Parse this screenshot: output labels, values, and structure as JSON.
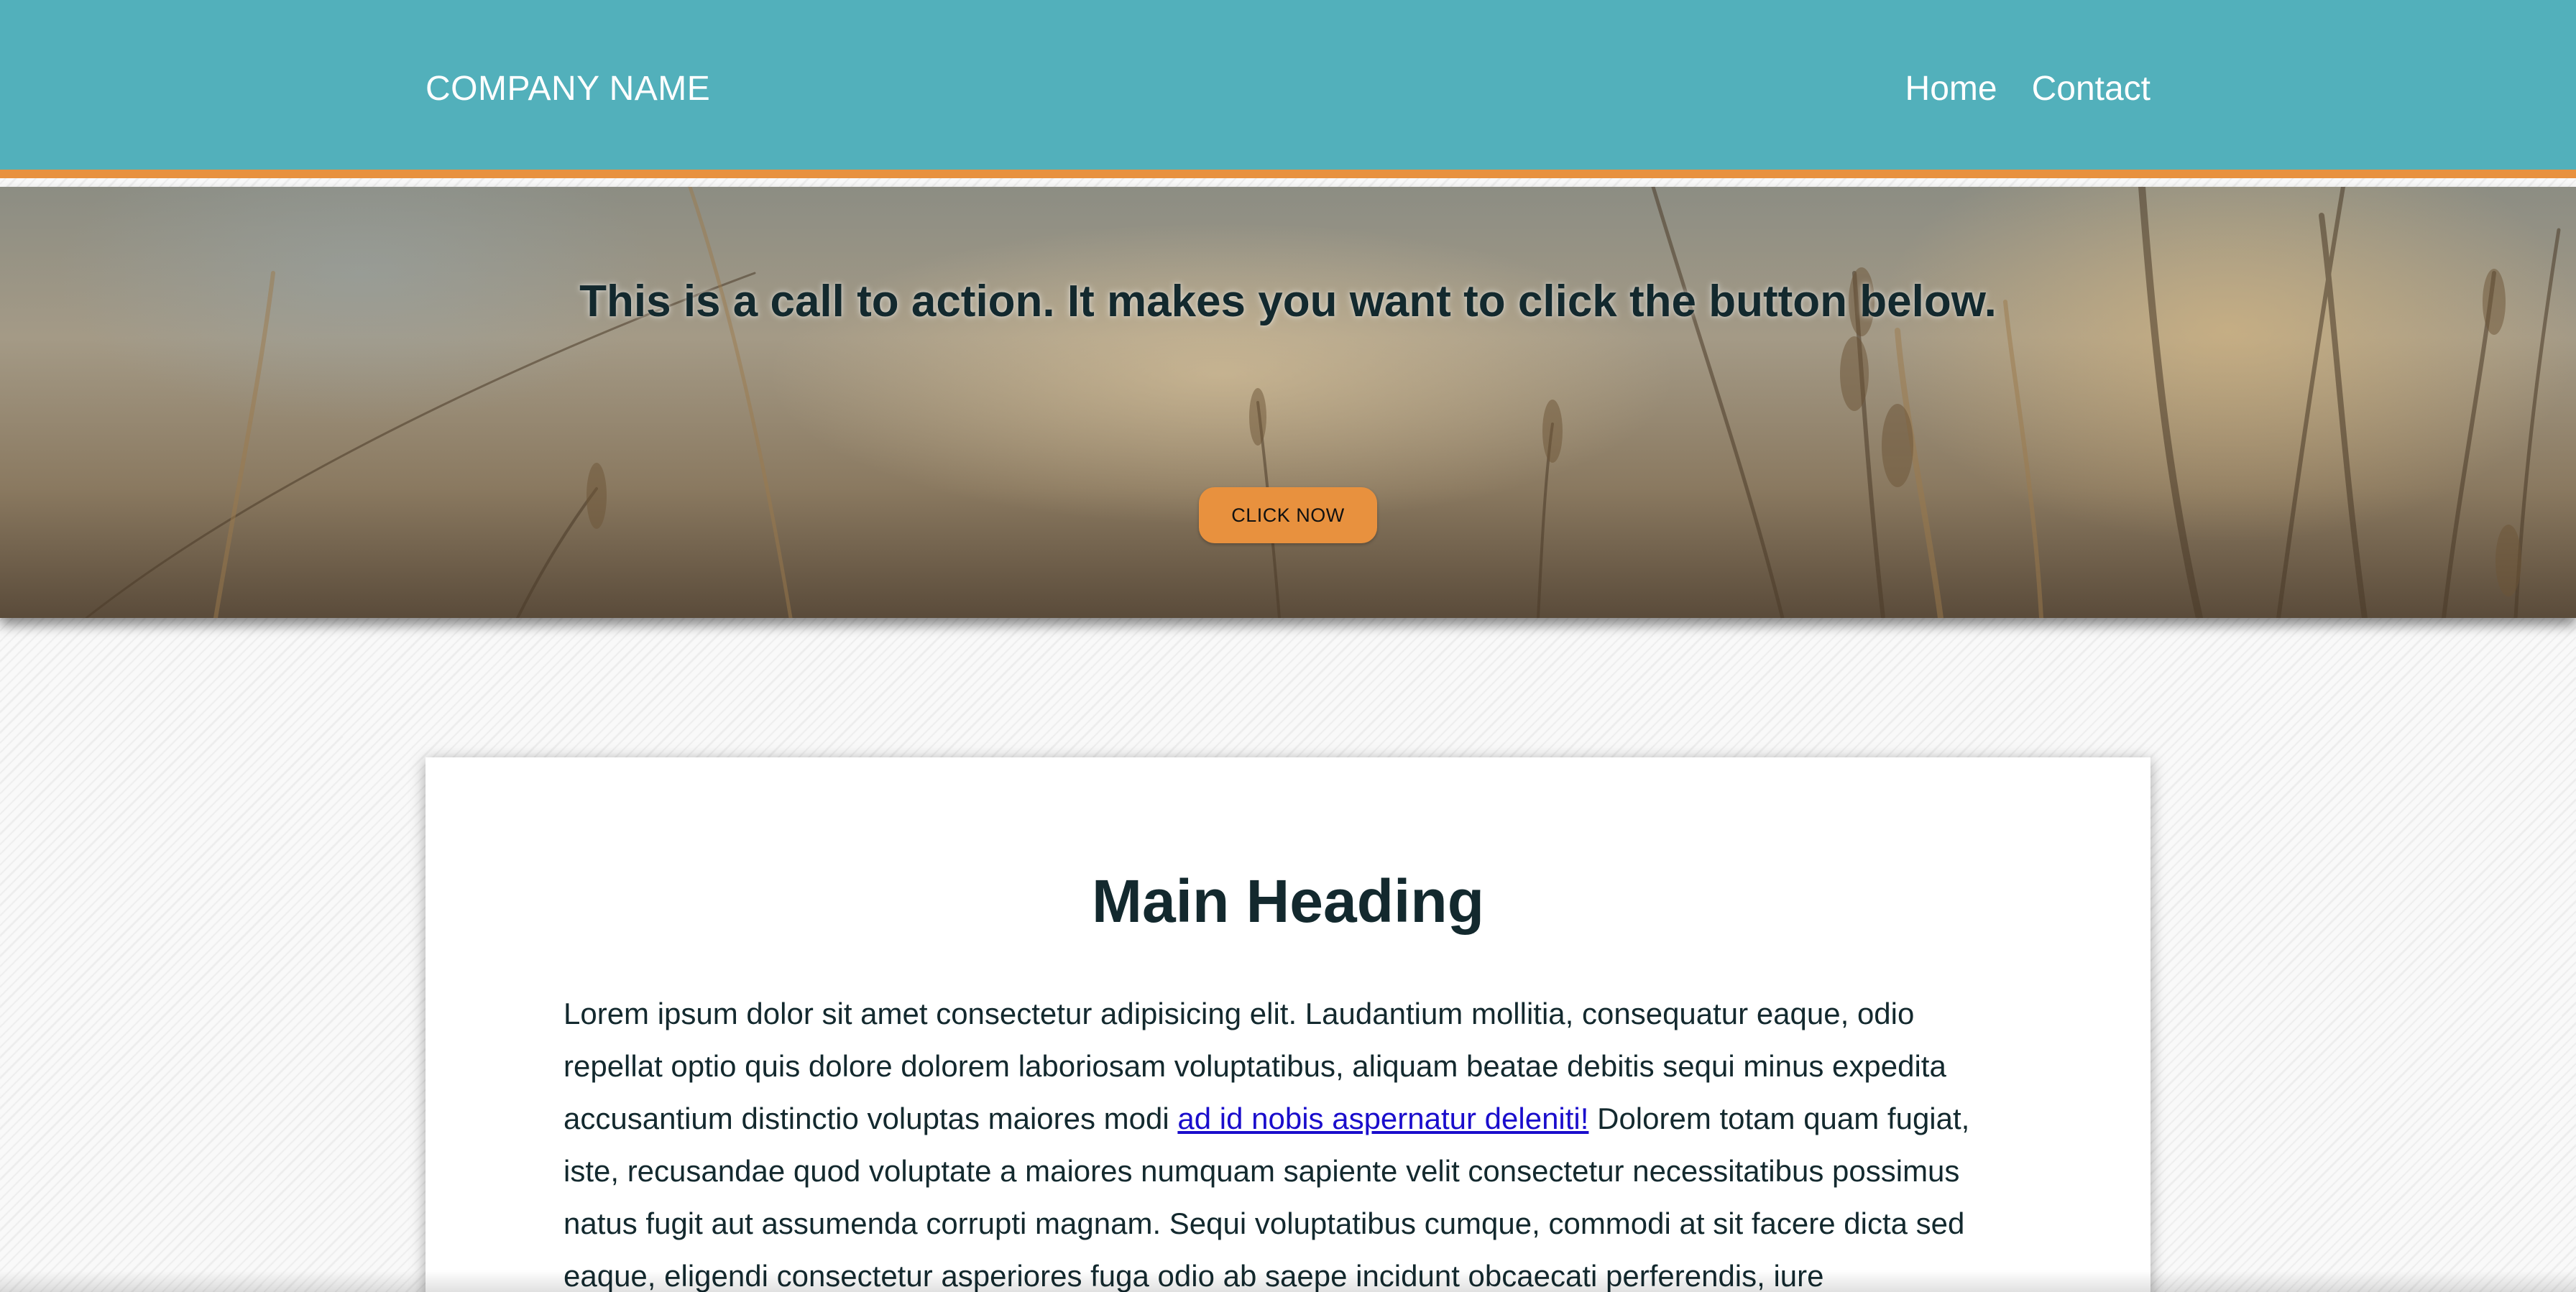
{
  "header": {
    "logo": "COMPANY NAME",
    "nav": [
      {
        "label": "Home"
      },
      {
        "label": "Contact"
      }
    ],
    "colors": {
      "background": "#52b0bb",
      "accent_border": "#e8913e"
    }
  },
  "hero": {
    "title": "This is a call to action. It makes you want to click the button below.",
    "button_label": "CLICK NOW",
    "background_image": "blurred wheat field photo"
  },
  "main": {
    "heading": "Main Heading",
    "paragraph_before_link": "Lorem ipsum dolor sit amet consectetur adipisicing elit. Laudantium mollitia, consequatur eaque, odio repellat optio quis dolore dolorem laboriosam voluptatibus, aliquam beatae debitis sequi minus expedita accusantium distinctio voluptas maiores modi ",
    "link_text": "ad id nobis aspernatur deleniti!",
    "paragraph_after_link": " Dolorem totam quam fugiat, iste, recusandae quod voluptate a maiores numquam sapiente velit consectetur necessitatibus possimus natus fugit aut assumenda corrupti magnam. Sequi voluptatibus cumque, commodi at sit facere dicta sed eaque, eligendi consectetur asperiores fuga odio ab saepe incidunt obcaecati perferendis, iure reprehenderit"
  }
}
